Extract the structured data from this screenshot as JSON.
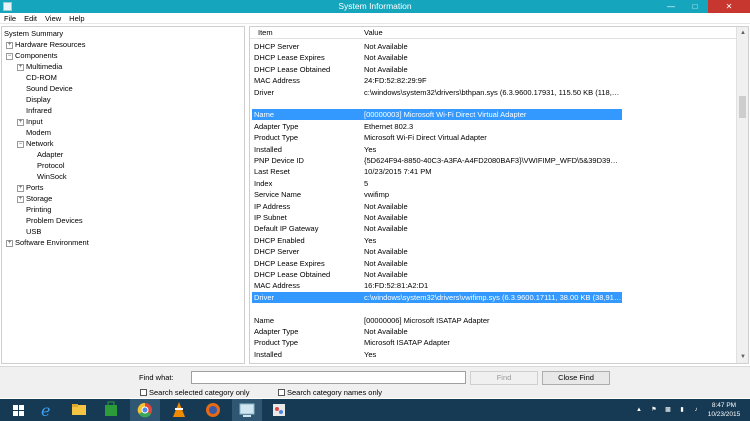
{
  "window": {
    "title": "System Information"
  },
  "menu": [
    "File",
    "Edit",
    "View",
    "Help"
  ],
  "tree": [
    {
      "label": "System Summary",
      "expander": ""
    },
    {
      "label": "Hardware Resources",
      "expander": "+"
    },
    {
      "label": "Components",
      "expander": "−"
    },
    {
      "label": "Multimedia",
      "expander": "+"
    },
    {
      "label": "CD-ROM",
      "expander": ""
    },
    {
      "label": "Sound Device",
      "expander": ""
    },
    {
      "label": "Display",
      "expander": ""
    },
    {
      "label": "Infrared",
      "expander": ""
    },
    {
      "label": "Input",
      "expander": "+"
    },
    {
      "label": "Modem",
      "expander": ""
    },
    {
      "label": "Network",
      "expander": "−"
    },
    {
      "label": "Adapter",
      "expander": ""
    },
    {
      "label": "Protocol",
      "expander": ""
    },
    {
      "label": "WinSock",
      "expander": ""
    },
    {
      "label": "Ports",
      "expander": "+"
    },
    {
      "label": "Storage",
      "expander": "+"
    },
    {
      "label": "Printing",
      "expander": ""
    },
    {
      "label": "Problem Devices",
      "expander": ""
    },
    {
      "label": "USB",
      "expander": ""
    },
    {
      "label": "Software Environment",
      "expander": "+"
    }
  ],
  "list": {
    "header_item": "Item",
    "header_value": "Value",
    "rows": [
      {
        "item": "DHCP Server",
        "value": "Not Available"
      },
      {
        "item": "DHCP Lease Expires",
        "value": "Not Available"
      },
      {
        "item": "DHCP Lease Obtained",
        "value": "Not Available"
      },
      {
        "item": "MAC Address",
        "value": "24:FD:52:82:29:9F"
      },
      {
        "item": "Driver",
        "value": "c:\\windows\\system32\\drivers\\bthpan.sys (6.3.9600.17931, 115.50 KB (118,272 ..."
      },
      {
        "item": "",
        "value": ""
      },
      {
        "item": "Name",
        "value": "[00000003] Microsoft Wi-Fi Direct Virtual Adapter"
      },
      {
        "item": "Adapter Type",
        "value": "Ethernet 802.3"
      },
      {
        "item": "Product Type",
        "value": "Microsoft Wi-Fi Direct Virtual Adapter"
      },
      {
        "item": "Installed",
        "value": "Yes"
      },
      {
        "item": "PNP Device ID",
        "value": "{5D624F94-8850-40C3-A3FA-A4FD2080BAF3}\\VWIFIMP_WFD\\5&39D39B29&0&..."
      },
      {
        "item": "Last Reset",
        "value": "10/23/2015 7:41 PM"
      },
      {
        "item": "Index",
        "value": "5"
      },
      {
        "item": "Service Name",
        "value": "vwifimp"
      },
      {
        "item": "IP Address",
        "value": "Not Available"
      },
      {
        "item": "IP Subnet",
        "value": "Not Available"
      },
      {
        "item": "Default IP Gateway",
        "value": "Not Available"
      },
      {
        "item": "DHCP Enabled",
        "value": "Yes"
      },
      {
        "item": "DHCP Server",
        "value": "Not Available"
      },
      {
        "item": "DHCP Lease Expires",
        "value": "Not Available"
      },
      {
        "item": "DHCP Lease Obtained",
        "value": "Not Available"
      },
      {
        "item": "MAC Address",
        "value": "16:FD:52:81:A2:D1"
      },
      {
        "item": "Driver",
        "value": "c:\\windows\\system32\\drivers\\vwifimp.sys (6.3.9600.17111, 38.00 KB (38,912 by..."
      },
      {
        "item": "",
        "value": ""
      },
      {
        "item": "Name",
        "value": "[00000006] Microsoft ISATAP Adapter"
      },
      {
        "item": "Adapter Type",
        "value": "Not Available"
      },
      {
        "item": "Product Type",
        "value": "Microsoft ISATAP Adapter"
      },
      {
        "item": "Installed",
        "value": "Yes"
      }
    ]
  },
  "find": {
    "label": "Find what:",
    "value": "",
    "find_button": "Find",
    "close_button": "Close Find",
    "search_selected": "Search selected category only",
    "search_names": "Search category names only"
  },
  "taskbar": {
    "apps": [
      "start-icon",
      "ie-icon",
      "file-explorer-icon",
      "store-icon",
      "chrome-icon",
      "vlc-icon",
      "firefox-icon",
      "system-information-icon",
      "paint-icon"
    ],
    "time": "8:47 PM",
    "date": "10/23/2015"
  }
}
